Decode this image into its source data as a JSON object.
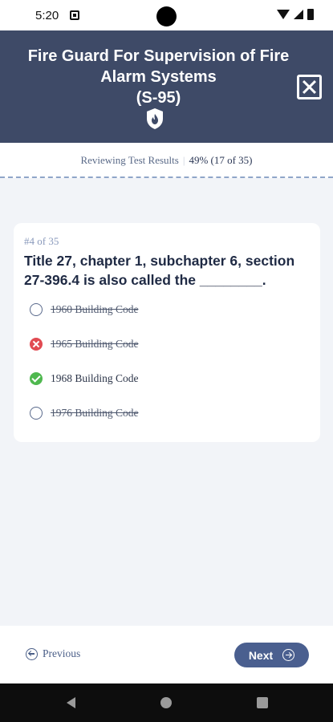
{
  "status_bar": {
    "time": "5:20"
  },
  "header": {
    "title_line1": "Fire Guard For Supervision of Fire",
    "title_line2": "Alarm Systems",
    "title_line3": "(S-95)"
  },
  "results": {
    "label": "Reviewing Test Results",
    "separator": "|",
    "score": "49% (17 of 35)"
  },
  "question": {
    "counter": "#4 of 35",
    "text": "Title 27, chapter 1, subchapter 6, section 27-396.4 is also called the ________.",
    "options": [
      {
        "label": "1960 Building Code",
        "state": "unselected-struck"
      },
      {
        "label": "1965 Building Code",
        "state": "wrong-struck"
      },
      {
        "label": "1968 Building Code",
        "state": "correct"
      },
      {
        "label": "1976 Building Code",
        "state": "unselected-struck"
      }
    ]
  },
  "footer": {
    "previous_label": "Previous",
    "next_label": "Next"
  },
  "colors": {
    "header_bg": "#3e4a67",
    "accent": "#4a5f8f",
    "correct": "#4fb84f",
    "wrong": "#e14b52"
  },
  "icons": {
    "close": "close-x-square-icon",
    "fire_badge": "fire-shield-icon",
    "previous": "arrow-left-circle-icon",
    "next": "arrow-right-circle-icon"
  }
}
